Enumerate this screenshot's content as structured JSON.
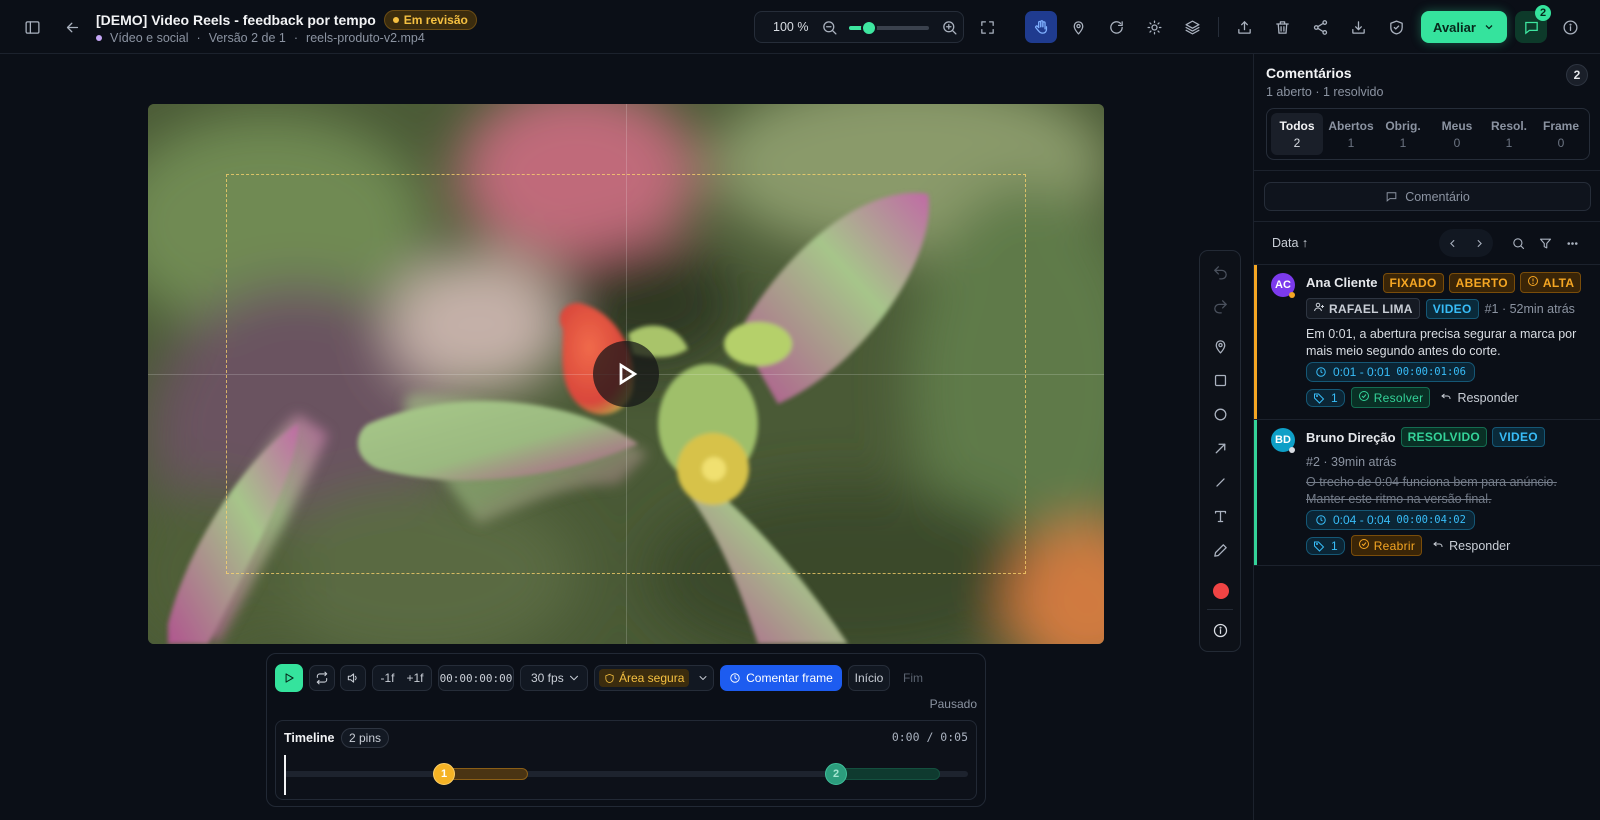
{
  "header": {
    "title": "[DEMO] Video Reels - feedback por tempo",
    "status": "Em revisão",
    "category": "Vídeo e social",
    "version": "Versão 2 de 1",
    "filename": "reels-produto-v2.mp4",
    "zoom": "100 %",
    "zoom_level": 0.25,
    "evaluate_label": "Avaliar",
    "comments_count": "2"
  },
  "controls": {
    "frame_back": "-1f",
    "frame_forward": "+1f",
    "timecode": "00:00:00:00",
    "fps": "30 fps",
    "safe_area": "Área segura",
    "comment_frame": "Comentar frame",
    "start": "Início",
    "end": "Fim",
    "state": "Pausado"
  },
  "timeline": {
    "label": "Timeline",
    "pins_label": "2 pins",
    "time": "0:00 / 0:05",
    "pins": [
      {
        "number": "1",
        "color": "#f5b325"
      },
      {
        "number": "2",
        "color": "#2c9d7d"
      }
    ]
  },
  "panel": {
    "title": "Comentários",
    "subtitle": "1 aberto · 1 resolvido",
    "count": "2",
    "filters": [
      {
        "label": "Todos",
        "count": "2"
      },
      {
        "label": "Abertos",
        "count": "1"
      },
      {
        "label": "Obrig.",
        "count": "1"
      },
      {
        "label": "Meus",
        "count": "0"
      },
      {
        "label": "Resol.",
        "count": "1"
      },
      {
        "label": "Frame",
        "count": "0"
      }
    ],
    "comment_button": "Comentário",
    "sort_label": "Data ↑"
  },
  "comments": [
    {
      "initials": "AC",
      "author": "Ana Cliente",
      "tags": [
        "FIXADO",
        "ABERTO",
        "ALTA"
      ],
      "assignee": "RAFAEL LIMA",
      "type": "VIDEO",
      "meta": "#1 · 52min atrás",
      "text": "Em 0:01, a abertura precisa segurar a marca por mais meio segundo antes do corte.",
      "time_range": "0:01 - 0:01",
      "timecode": "00:00:01:06",
      "attachments": "1",
      "action": "Resolver",
      "reply": "Responder"
    },
    {
      "initials": "BD",
      "author": "Bruno Direção",
      "tags": [
        "RESOLVIDO"
      ],
      "type": "VIDEO",
      "meta": "#2 · 39min atrás",
      "text": "O trecho de 0:04 funciona bem para anúncio. Manter este ritmo na versão final.",
      "time_range": "0:04 - 0:04",
      "timecode": "00:00:04:02",
      "attachments": "1",
      "action": "Reabrir",
      "reply": "Responder"
    }
  ],
  "colors": {
    "accent": "#35e39d",
    "open": "#f5a623",
    "resolved": "#34d399",
    "video": "#38bdf8"
  }
}
